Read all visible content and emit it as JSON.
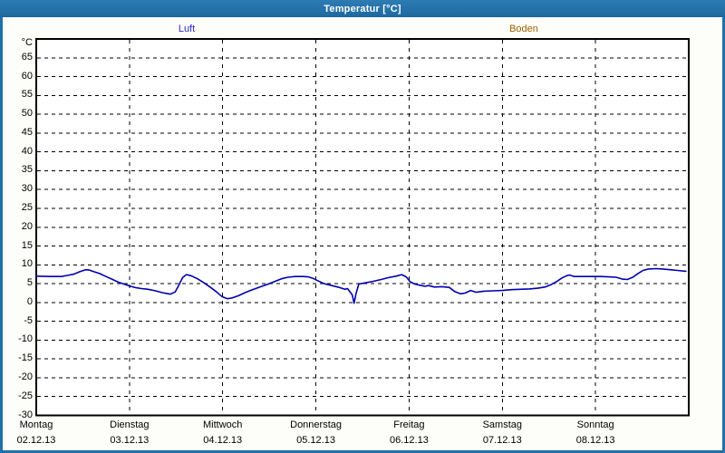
{
  "window": {
    "title": "Temperatur [°C]"
  },
  "colors": {
    "titlebar": "#2171a9",
    "window_border": "#2171a9",
    "plot_frame": "#000000",
    "gridline": "#000000",
    "luft_line": "#0000b0",
    "luft_legend": "#2a2acc",
    "boden_legend": "#9c6200",
    "plot_background": "#ffffff"
  },
  "legend": {
    "items": [
      {
        "label": "Luft",
        "color": "#2a2acc"
      },
      {
        "label": "Boden",
        "color": "#9c6200"
      }
    ]
  },
  "chart_data": {
    "type": "line",
    "title": "Temperatur [°C]",
    "ylabel": "°C",
    "ylim": [
      -30,
      70
    ],
    "grid": "dashed",
    "legend_position": "top",
    "y_axis": {
      "unit": "°C",
      "ticks": [
        65,
        60,
        55,
        50,
        45,
        40,
        35,
        30,
        25,
        20,
        15,
        10,
        5,
        0,
        -5,
        -10,
        -15,
        -20,
        -25,
        -30
      ]
    },
    "x_axis": {
      "days": [
        {
          "name": "Montag",
          "date": "02.12.13"
        },
        {
          "name": "Dienstag",
          "date": "03.12.13"
        },
        {
          "name": "Mittwoch",
          "date": "04.12.13"
        },
        {
          "name": "Donnerstag",
          "date": "05.12.13"
        },
        {
          "name": "Freitag",
          "date": "06.12.13"
        },
        {
          "name": "Samstag",
          "date": "07.12.13"
        },
        {
          "name": "Sonntag",
          "date": "08.12.13"
        }
      ]
    },
    "series": [
      {
        "name": "Luft",
        "color": "#0000b0",
        "x_unit": "days_from_monday",
        "points": [
          [
            0.0,
            7.0
          ],
          [
            0.15,
            6.9
          ],
          [
            0.27,
            6.9
          ],
          [
            0.34,
            7.2
          ],
          [
            0.4,
            7.5
          ],
          [
            0.47,
            8.2
          ],
          [
            0.53,
            8.7
          ],
          [
            0.57,
            8.6
          ],
          [
            0.63,
            8.1
          ],
          [
            0.68,
            7.7
          ],
          [
            0.74,
            7.0
          ],
          [
            0.82,
            6.1
          ],
          [
            0.88,
            5.4
          ],
          [
            0.95,
            4.8
          ],
          [
            1.0,
            4.4
          ],
          [
            1.07,
            3.9
          ],
          [
            1.13,
            3.7
          ],
          [
            1.2,
            3.5
          ],
          [
            1.28,
            3.1
          ],
          [
            1.35,
            2.6
          ],
          [
            1.42,
            2.3
          ],
          [
            1.44,
            2.2
          ],
          [
            1.49,
            2.8
          ],
          [
            1.53,
            4.6
          ],
          [
            1.57,
            6.6
          ],
          [
            1.61,
            7.4
          ],
          [
            1.66,
            7.1
          ],
          [
            1.73,
            6.3
          ],
          [
            1.8,
            5.2
          ],
          [
            1.87,
            4.0
          ],
          [
            1.93,
            2.9
          ],
          [
            1.99,
            1.6
          ],
          [
            2.05,
            1.0
          ],
          [
            2.1,
            1.2
          ],
          [
            2.17,
            1.8
          ],
          [
            2.24,
            2.6
          ],
          [
            2.32,
            3.4
          ],
          [
            2.41,
            4.2
          ],
          [
            2.49,
            4.9
          ],
          [
            2.56,
            5.6
          ],
          [
            2.63,
            6.3
          ],
          [
            2.7,
            6.7
          ],
          [
            2.78,
            6.9
          ],
          [
            2.86,
            6.9
          ],
          [
            2.92,
            6.8
          ],
          [
            2.97,
            6.4
          ],
          [
            3.02,
            5.8
          ],
          [
            3.09,
            5.0
          ],
          [
            3.17,
            4.5
          ],
          [
            3.25,
            4.0
          ],
          [
            3.31,
            3.5
          ],
          [
            3.34,
            3.7
          ],
          [
            3.39,
            2.0
          ],
          [
            3.41,
            -0.2
          ],
          [
            3.43,
            2.3
          ],
          [
            3.46,
            4.9
          ],
          [
            3.53,
            5.2
          ],
          [
            3.61,
            5.6
          ],
          [
            3.7,
            6.1
          ],
          [
            3.78,
            6.6
          ],
          [
            3.86,
            7.0
          ],
          [
            3.92,
            7.4
          ],
          [
            3.97,
            6.8
          ],
          [
            4.01,
            5.5
          ],
          [
            4.06,
            4.9
          ],
          [
            4.11,
            4.6
          ],
          [
            4.17,
            4.3
          ],
          [
            4.21,
            4.5
          ],
          [
            4.27,
            4.1
          ],
          [
            4.35,
            4.2
          ],
          [
            4.43,
            4.0
          ],
          [
            4.49,
            2.9
          ],
          [
            4.55,
            2.3
          ],
          [
            4.6,
            2.5
          ],
          [
            4.66,
            3.2
          ],
          [
            4.72,
            2.7
          ],
          [
            4.8,
            3.0
          ],
          [
            4.9,
            3.1
          ],
          [
            5.0,
            3.2
          ],
          [
            5.1,
            3.4
          ],
          [
            5.19,
            3.5
          ],
          [
            5.29,
            3.6
          ],
          [
            5.38,
            3.8
          ],
          [
            5.46,
            4.1
          ],
          [
            5.52,
            4.7
          ],
          [
            5.58,
            5.5
          ],
          [
            5.64,
            6.5
          ],
          [
            5.69,
            7.1
          ],
          [
            5.72,
            7.3
          ],
          [
            5.77,
            6.9
          ],
          [
            5.85,
            6.9
          ],
          [
            5.95,
            6.9
          ],
          [
            6.05,
            6.9
          ],
          [
            6.14,
            6.8
          ],
          [
            6.22,
            6.7
          ],
          [
            6.29,
            6.2
          ],
          [
            6.34,
            6.1
          ],
          [
            6.4,
            6.7
          ],
          [
            6.45,
            7.6
          ],
          [
            6.51,
            8.5
          ],
          [
            6.57,
            8.9
          ],
          [
            6.65,
            9.0
          ],
          [
            6.72,
            8.9
          ],
          [
            6.8,
            8.7
          ],
          [
            6.88,
            8.5
          ],
          [
            6.97,
            8.3
          ]
        ]
      },
      {
        "name": "Boden",
        "color": "#9c6200",
        "x_unit": "days_from_monday",
        "points": []
      }
    ]
  }
}
